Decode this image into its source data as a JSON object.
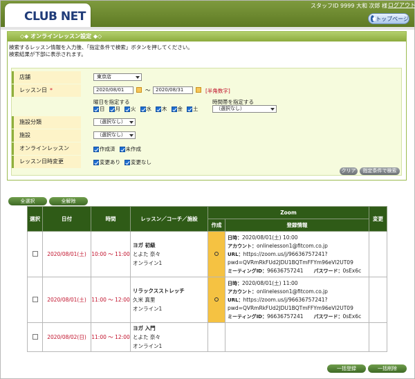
{
  "header": {
    "logo": "CLUB NET",
    "user": "スタッフID 9999  大和 次郎 様",
    "logout": "ログアウト",
    "top_page": "トップページ"
  },
  "section": {
    "title": "◇◆ オンラインレッスン設定 ◆◇",
    "desc1": "検索するレッスン情報を入力後、「指定条件で検索」ボタンを押してください。",
    "desc2": "検索結果が下部に表示されます。"
  },
  "form": {
    "store_label": "店舗",
    "store_value": "東京店",
    "date_label": "レッスン日",
    "required_mark": "*",
    "date_from": "2020/08/01",
    "date_sep": "～",
    "date_to": "2020/08/31",
    "date_note": "[半角数字]",
    "weekday_label": "曜日を指定する",
    "weekdays": [
      "日",
      "月",
      "火",
      "水",
      "木",
      "金",
      "土"
    ],
    "timeslot_label": "時間帯を指定する",
    "timeslot_value": "（選択なし）",
    "facility_type_label": "施設分類",
    "facility_type_value": "（選択なし）",
    "facility_label": "施設",
    "facility_value": "（選択なし）",
    "online_label": "オンラインレッスン",
    "online_opts": [
      "作成済",
      "未作成"
    ],
    "change_label": "レッスン日時変更",
    "change_opts": [
      "変更あり",
      "変更なし"
    ],
    "clear_btn": "クリア",
    "search_btn": "指定条件で検索"
  },
  "actions": {
    "select_all": "全選択",
    "deselect_all": "全解除",
    "bulk_register": "一括登録",
    "bulk_delete": "一括削除"
  },
  "table": {
    "headers": {
      "select": "選択",
      "date": "日付",
      "time": "時間",
      "lesson": "レッスン／コーチ／施設",
      "zoom": "Zoom",
      "made": "作成",
      "reg_info": "登録情報",
      "change": "変更"
    },
    "rows": [
      {
        "date": "2020/08/01(土)",
        "time": "10:00 ～ 11:00",
        "lesson": "ヨガ 初級",
        "coach": "とよた 奈々",
        "facility": "オンライン1",
        "made": "○",
        "datetime_label": "日時：",
        "datetime": "2020/08/01(土) 10:00",
        "account_label": "アカウント：",
        "account": "onlinelesson1@fitcom.co.jp",
        "url_label": "URL：",
        "url1": "https://zoom.us/j/96636757241?",
        "url2": "pwd=QVRmRkFUd2JDU1BQTmFFYm96eVl2UT09",
        "meeting_label": "ミーティングID：",
        "meeting": "96636757241",
        "pass_label": "パスワード：",
        "pass": "0sEx6c"
      },
      {
        "date": "2020/08/01(土)",
        "time": "11:00 ～ 12:00",
        "lesson": "リラックスストレッチ",
        "coach": "久米 真里",
        "facility": "オンライン1",
        "made": "○",
        "datetime_label": "日時：",
        "datetime": "2020/08/01(土) 11:00",
        "account_label": "アカウント：",
        "account": "onlinelesson1@fitcom.co.jp",
        "url_label": "URL：",
        "url1": "https://zoom.us/j/96636757241?",
        "url2": "pwd=QVRmRkFUd2JDU1BQTmFFYm96eVl2UT09",
        "meeting_label": "ミーティングID：",
        "meeting": "96636757241",
        "pass_label": "パスワード：",
        "pass": "0sEx6c"
      },
      {
        "date": "2020/08/02(日)",
        "time": "11:00 ～ 12:00",
        "lesson": "ヨガ 入門",
        "coach": "とよた 奈々",
        "facility": "オンライン1"
      }
    ]
  },
  "colors": {
    "header_green": "#6e8a30",
    "table_header": "#2f5b17",
    "date_red": "#c0102a",
    "made_yellow": "#f5c242"
  }
}
